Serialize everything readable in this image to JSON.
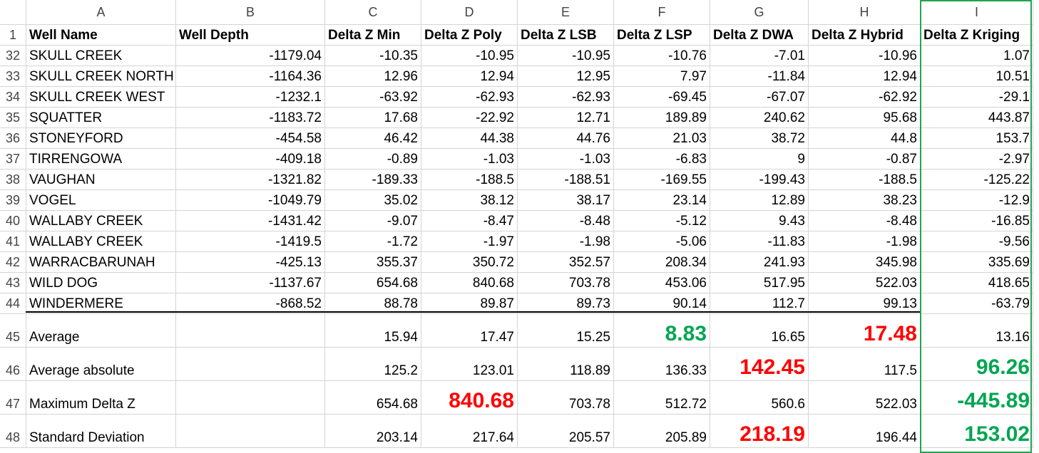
{
  "columns": [
    "A",
    "B",
    "C",
    "D",
    "E",
    "F",
    "G",
    "H",
    "I"
  ],
  "headerRow": {
    "num": "1",
    "cells": [
      "Well Name",
      "Well Depth",
      "Delta Z Min",
      "Delta Z Poly",
      "Delta Z LSB",
      "Delta Z LSP",
      "Delta Z DWA",
      "Delta Z Hybrid",
      "Delta Z Kriging"
    ]
  },
  "rows": [
    {
      "num": "32",
      "cells": [
        "SKULL CREEK",
        "-1179.04",
        "-10.35",
        "-10.95",
        "-10.95",
        "-10.76",
        "-7.01",
        "-10.96",
        "1.07"
      ]
    },
    {
      "num": "33",
      "cells": [
        "SKULL CREEK NORTH",
        "-1164.36",
        "12.96",
        "12.94",
        "12.95",
        "7.97",
        "-11.84",
        "12.94",
        "10.51"
      ]
    },
    {
      "num": "34",
      "cells": [
        "SKULL CREEK WEST",
        "-1232.1",
        "-63.92",
        "-62.93",
        "-62.93",
        "-69.45",
        "-67.07",
        "-62.92",
        "-29.1"
      ]
    },
    {
      "num": "35",
      "cells": [
        "SQUATTER",
        "-1183.72",
        "17.68",
        "-22.92",
        "12.71",
        "189.89",
        "240.62",
        "95.68",
        "443.87"
      ]
    },
    {
      "num": "36",
      "cells": [
        "STONEYFORD",
        "-454.58",
        "46.42",
        "44.38",
        "44.76",
        "21.03",
        "38.72",
        "44.8",
        "153.7"
      ]
    },
    {
      "num": "37",
      "cells": [
        "TIRRENGOWA",
        "-409.18",
        "-0.89",
        "-1.03",
        "-1.03",
        "-6.83",
        "9",
        "-0.87",
        "-2.97"
      ]
    },
    {
      "num": "38",
      "cells": [
        "VAUGHAN",
        "-1321.82",
        "-189.33",
        "-188.5",
        "-188.51",
        "-169.55",
        "-199.43",
        "-188.5",
        "-125.22"
      ]
    },
    {
      "num": "39",
      "cells": [
        "VOGEL",
        "-1049.79",
        "35.02",
        "38.12",
        "38.17",
        "23.14",
        "12.89",
        "38.23",
        "-12.9"
      ]
    },
    {
      "num": "40",
      "cells": [
        "WALLABY CREEK",
        "-1431.42",
        "-9.07",
        "-8.47",
        "-8.48",
        "-5.12",
        "9.43",
        "-8.48",
        "-16.85"
      ]
    },
    {
      "num": "41",
      "cells": [
        "WALLABY CREEK",
        "-1419.5",
        "-1.72",
        "-1.97",
        "-1.98",
        "-5.06",
        "-11.83",
        "-1.98",
        "-9.56"
      ]
    },
    {
      "num": "42",
      "cells": [
        "WARRACBARUNAH",
        "-425.13",
        "355.37",
        "350.72",
        "352.57",
        "208.34",
        "241.93",
        "345.98",
        "335.69"
      ]
    },
    {
      "num": "43",
      "cells": [
        "WILD DOG",
        "-1137.67",
        "654.68",
        "840.68",
        "703.78",
        "453.06",
        "517.95",
        "522.03",
        "418.65"
      ]
    },
    {
      "num": "44",
      "cells": [
        "WINDERMERE",
        "-868.52",
        "88.78",
        "89.87",
        "89.73",
        "90.14",
        "112.7",
        "99.13",
        "-63.79"
      ]
    }
  ],
  "stats": [
    {
      "num": "45",
      "label": "Average",
      "cells": [
        "",
        "15.94",
        "17.47",
        "15.25",
        "8.83",
        "16.65",
        "17.48",
        "13.16"
      ],
      "styles": [
        "",
        "",
        "",
        "",
        "big green",
        "",
        "big red",
        ""
      ]
    },
    {
      "num": "46",
      "label": "Average absolute",
      "cells": [
        "",
        "125.2",
        "123.01",
        "118.89",
        "136.33",
        "142.45",
        "117.5",
        "96.26"
      ],
      "styles": [
        "",
        "",
        "",
        "",
        "",
        "big red",
        "",
        "big green"
      ]
    },
    {
      "num": "47",
      "label": "Maximum Delta Z",
      "cells": [
        "",
        "654.68",
        "840.68",
        "703.78",
        "512.72",
        "560.6",
        "522.03",
        "-445.89"
      ],
      "styles": [
        "",
        "",
        "big red",
        "",
        "",
        "",
        "",
        "big green"
      ]
    },
    {
      "num": "48",
      "label": "Standard Deviation",
      "cells": [
        "",
        "203.14",
        "217.64",
        "205.57",
        "205.89",
        "218.19",
        "196.44",
        "153.02"
      ],
      "styles": [
        "",
        "",
        "",
        "",
        "",
        "big red",
        "",
        "big green"
      ]
    }
  ],
  "colors": {
    "highlight_red": "#ff0000",
    "highlight_green": "#00a651",
    "selection_border": "#22a450"
  }
}
